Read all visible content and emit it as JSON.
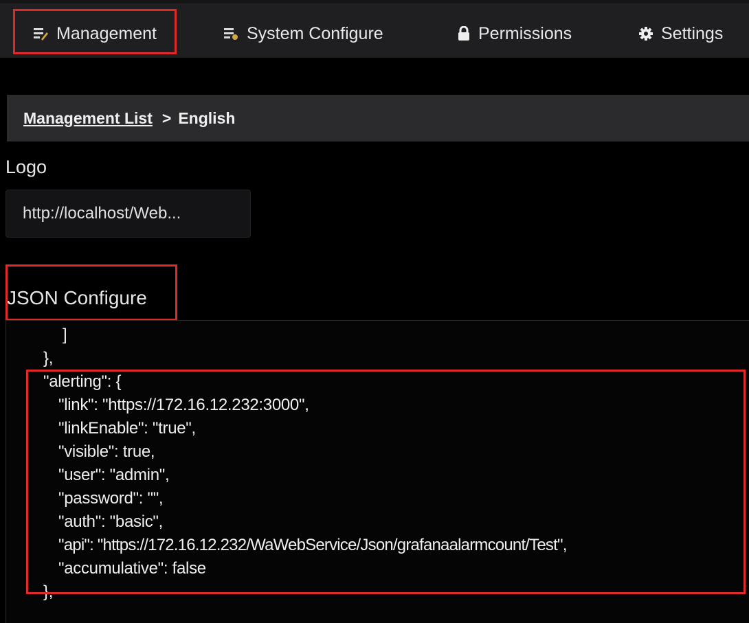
{
  "tabs": [
    {
      "label": "Management",
      "icon": "management-icon"
    },
    {
      "label": "System Configure",
      "icon": "system-configure-icon"
    },
    {
      "label": "Permissions",
      "icon": "lock-icon"
    },
    {
      "label": "Settings",
      "icon": "gear-icon"
    }
  ],
  "breadcrumb": {
    "link": "Management List",
    "separator": ">",
    "current": "English"
  },
  "logo": {
    "label": "Logo",
    "value": "http://localhost/Web..."
  },
  "json_config": {
    "label": "JSON Configure",
    "lines": [
      "]",
      "},",
      "\"alerting\": {",
      "\"link\": \"https://172.16.12.232:3000\",",
      "\"linkEnable\": \"true\",",
      "\"visible\": true,",
      "\"user\": \"admin\",",
      "\"password\": \"\",",
      "\"auth\": \"basic\",",
      "\"api\": \"https://172.16.12.232/WaWebService/Json/grafanaalarmcount/Test\",",
      "\"accumulative\": false",
      "},"
    ]
  },
  "colors": {
    "highlight": "#e02a2a",
    "background": "#000000",
    "tab_bar": "#1f1f21",
    "breadcrumb_bg": "#2b2b2d"
  }
}
